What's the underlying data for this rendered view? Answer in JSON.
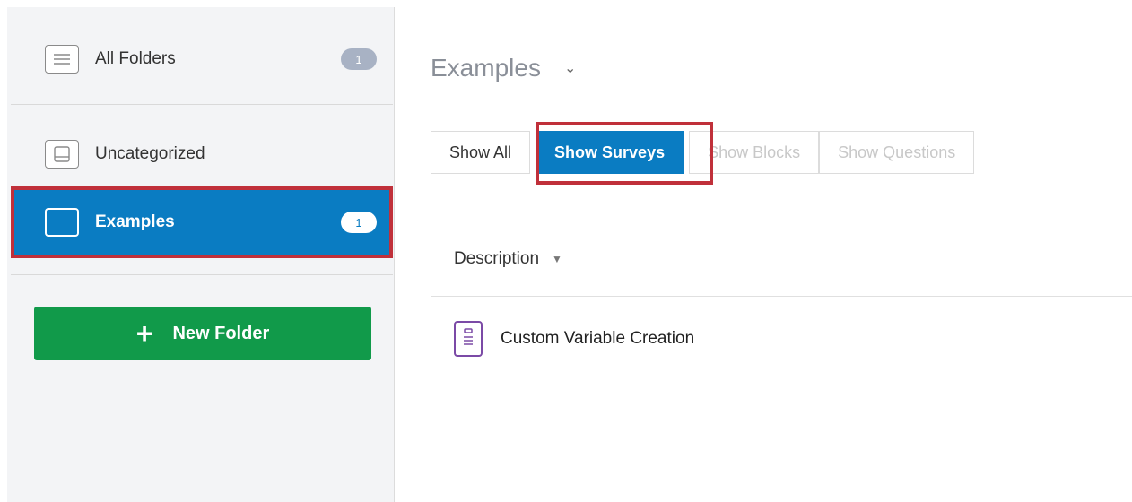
{
  "sidebar": {
    "items": [
      {
        "label": "All Folders",
        "badge": "1",
        "icon": "list-icon"
      },
      {
        "label": "Uncategorized",
        "badge": "",
        "icon": "tray-icon"
      },
      {
        "label": "Examples",
        "badge": "1",
        "icon": "folder-icon",
        "selected": true
      }
    ],
    "new_folder_label": "New Folder"
  },
  "main": {
    "title": "Examples",
    "filters": [
      "Show All",
      "Show Surveys",
      "Show Blocks",
      "Show Questions"
    ],
    "active_filter": "Show Surveys",
    "column_header": "Description",
    "rows": [
      {
        "name": "Custom Variable Creation",
        "icon": "survey-clipboard-icon"
      }
    ]
  },
  "colors": {
    "primary_blue": "#0a7cc2",
    "green_button": "#119a4a",
    "highlight_red": "#c0303a",
    "badge_gray": "#a8b2c4",
    "survey_icon_purple": "#7b4aa6"
  }
}
